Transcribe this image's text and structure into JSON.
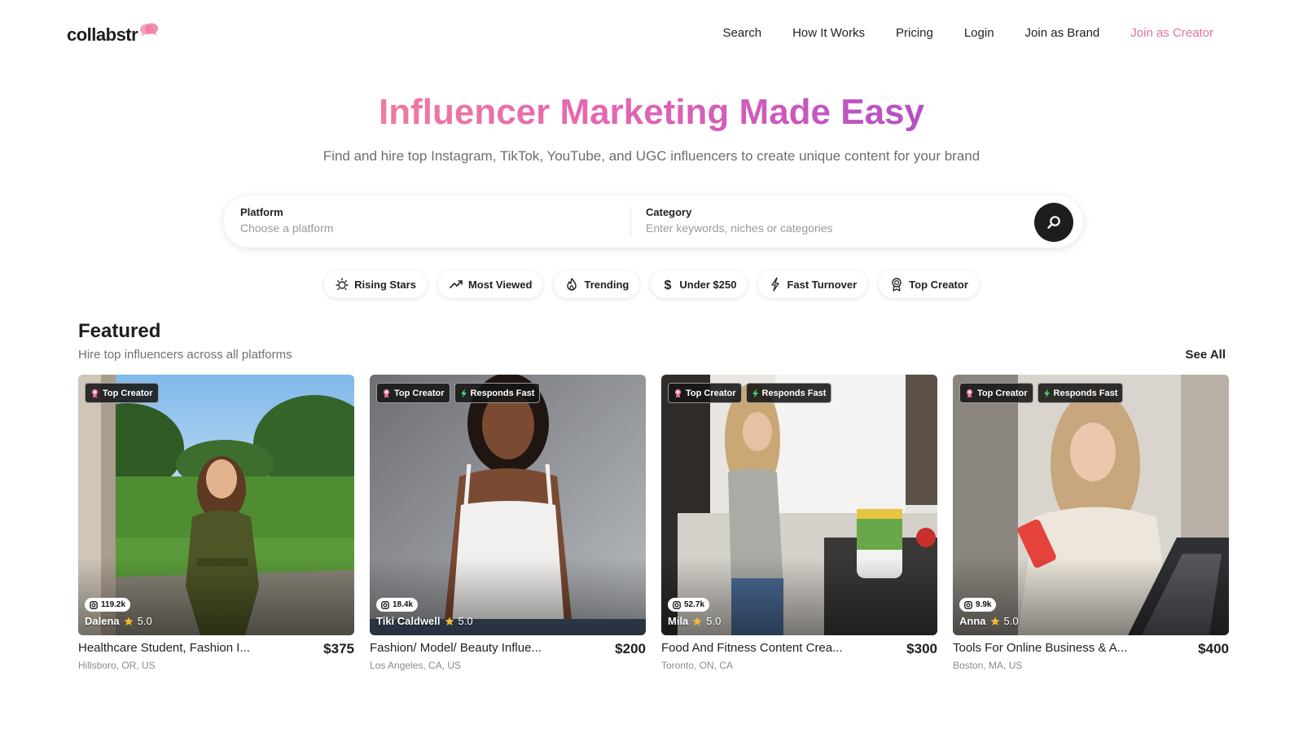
{
  "brand": {
    "name": "collabstr"
  },
  "nav": {
    "links": [
      {
        "label": "Search"
      },
      {
        "label": "How It Works"
      },
      {
        "label": "Pricing"
      },
      {
        "label": "Login"
      },
      {
        "label": "Join as Brand"
      },
      {
        "label": "Join as Creator"
      }
    ]
  },
  "hero": {
    "title": "Influencer Marketing Made Easy",
    "subtitle": "Find and hire top Instagram, TikTok, YouTube, and UGC influencers to create unique content for your brand"
  },
  "search": {
    "platform_label": "Platform",
    "platform_placeholder": "Choose a platform",
    "category_label": "Category",
    "category_placeholder": "Enter keywords, niches or categories"
  },
  "chips": [
    {
      "label": "Rising Stars",
      "icon": "sun-icon"
    },
    {
      "label": "Most Viewed",
      "icon": "trending-up-icon"
    },
    {
      "label": "Trending",
      "icon": "flame-icon"
    },
    {
      "label": "Under $250",
      "icon": "dollar-icon"
    },
    {
      "label": "Fast Turnover",
      "icon": "bolt-icon"
    },
    {
      "label": "Top Creator",
      "icon": "award-icon"
    }
  ],
  "featured": {
    "title": "Featured",
    "subtitle": "Hire top influencers across all platforms",
    "see_all": "See All",
    "cards": [
      {
        "name": "Dalena",
        "rating": "5.0",
        "followers": "119.2k",
        "title": "Healthcare Student, Fashion I...",
        "price": "$375",
        "location": "Hillsboro, OR, US",
        "badges": [
          "Top Creator"
        ]
      },
      {
        "name": "Tiki Caldwell",
        "rating": "5.0",
        "followers": "18.4k",
        "title": "Fashion/ Model/ Beauty Influe...",
        "price": "$200",
        "location": "Los Angeles, CA, US",
        "badges": [
          "Top Creator",
          "Responds Fast"
        ]
      },
      {
        "name": "Mila",
        "rating": "5.0",
        "followers": "52.7k",
        "title": "Food And Fitness Content Crea...",
        "price": "$300",
        "location": "Toronto, ON, CA",
        "badges": [
          "Top Creator",
          "Responds Fast"
        ]
      },
      {
        "name": "Anna",
        "rating": "5.0",
        "followers": "9.9k",
        "title": "Tools For Online Business & A...",
        "price": "$400",
        "location": "Boston, MA, US",
        "badges": [
          "Top Creator",
          "Responds Fast"
        ]
      }
    ]
  },
  "colors": {
    "accent_pink": "#e070a8",
    "gradient_start": "#f07aa0",
    "gradient_end": "#b44fc6",
    "search_button": "#1d1d1d",
    "star": "#f5b82e",
    "responds_fast_bolt": "#3ddc6b"
  }
}
